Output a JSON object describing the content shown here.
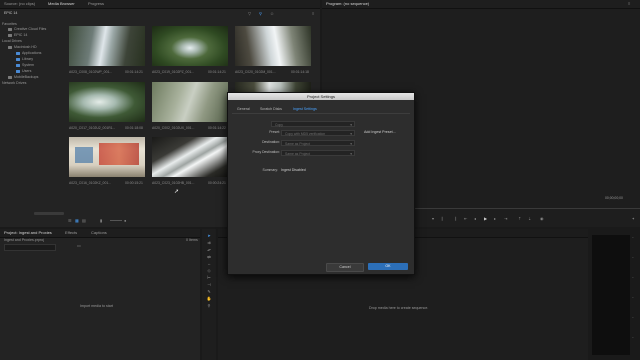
{
  "source_panel": {
    "tabs": [
      "Source: (no clips)",
      "Media Browser",
      "Progress"
    ],
    "active_tab": 1
  },
  "program_panel": {
    "title": "Program: (no sequence)",
    "timecode_right": "00;00;00;00"
  },
  "media_browser": {
    "ingest_label": "EPIC 14",
    "tree": [
      {
        "label": "Favorites",
        "indent": 0
      },
      {
        "label": "Creative Cloud Files",
        "indent": 1
      },
      {
        "label": "EPIC 14",
        "indent": 1
      },
      {
        "label": "Local Drives",
        "indent": 0
      },
      {
        "label": "Macintosh HD",
        "indent": 1
      },
      {
        "label": "Applications",
        "indent": 2
      },
      {
        "label": "Library",
        "indent": 2
      },
      {
        "label": "System",
        "indent": 2
      },
      {
        "label": "Users",
        "indent": 2
      },
      {
        "label": "MobileBackups",
        "indent": 1
      },
      {
        "label": "Network Drives",
        "indent": 0
      }
    ],
    "clips": [
      {
        "name": "A023_C008_0102WP_001...",
        "duration": "00:01:14:21"
      },
      {
        "name": "A023_C019_0102PZ_001...",
        "duration": "00:01:14:21"
      },
      {
        "name": "A023_C020_0102M_001...",
        "duration": "00:01:14:18"
      },
      {
        "name": "A020_C017_0102U2_001R1...",
        "duration": "00:01:18:08"
      },
      {
        "name": "A020_C002_0102UX_001...",
        "duration": "00:01:14:22"
      },
      {
        "name": "A020_C012_010212_001...",
        "duration": "00:01:01:21"
      },
      {
        "name": "A023_C016_0102KZ_001...",
        "duration": "00:00:15:21"
      },
      {
        "name": "A023_C023_0102HB_001...",
        "duration": "00:00:24:21"
      }
    ]
  },
  "project_panel": {
    "tabs": [
      "Project: Ingest and Proxies",
      "Effects",
      "Captions"
    ],
    "file": "Ingest and Proxies.prproj",
    "item_count": "0 Items",
    "empty_message": "Import media to start"
  },
  "timeline_panel": {
    "empty_message": "Drop media here to create sequence."
  },
  "dialog": {
    "title": "Project Settings",
    "tabs": [
      "General",
      "Scratch Disks",
      "Ingest Settings"
    ],
    "active_tab": 2,
    "ingest_label": "Ingest",
    "ingest_value": "Copy",
    "preset_label": "Preset:",
    "preset_value": "Copy with MD5 verification",
    "add_preset_label": "Add Ingest Preset...",
    "destination_label": "Destination:",
    "destination_value": "Same as Project",
    "proxy_label": "Proxy Destination:",
    "proxy_value": "Same as Project",
    "summary_label": "Summary:",
    "summary_value": "Ingest Disabled",
    "cancel_label": "Cancel",
    "ok_label": "OK"
  },
  "colors": {
    "accent": "#4aa3ff",
    "ok_button": "#2c6fb8"
  }
}
